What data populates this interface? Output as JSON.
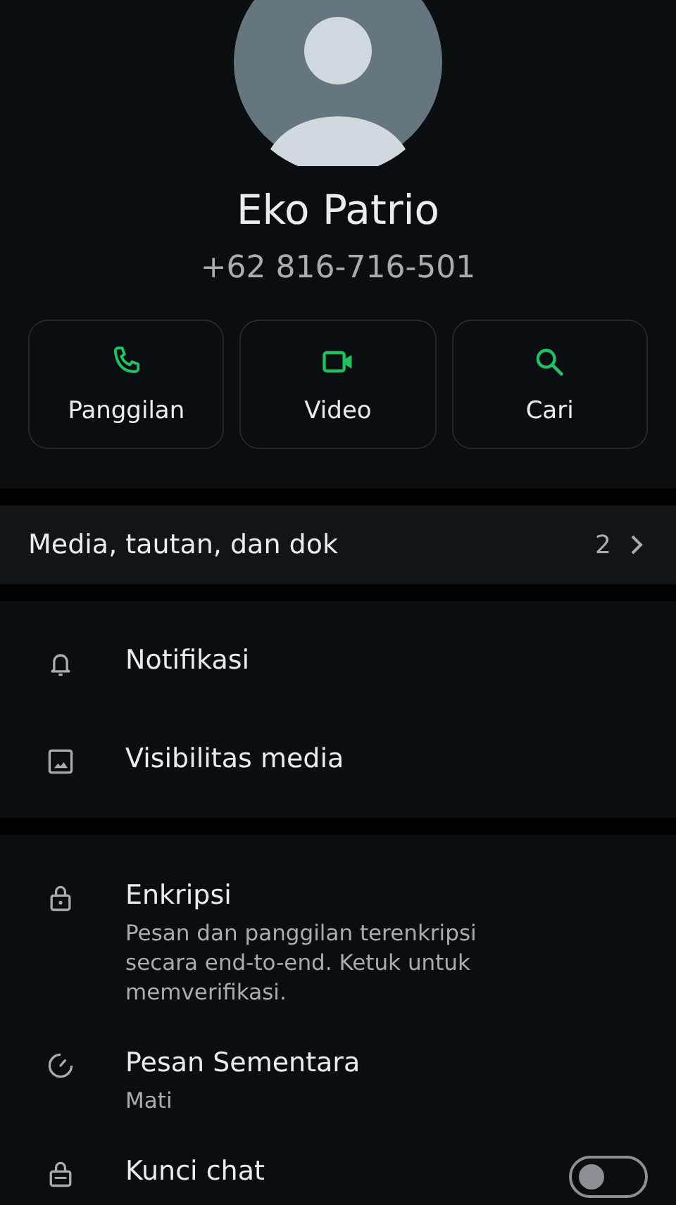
{
  "contact": {
    "name": "Eko Patrio",
    "phone": "+62 816-716-501"
  },
  "actions": [
    {
      "kind": "call",
      "label": "Panggilan"
    },
    {
      "kind": "video",
      "label": "Video"
    },
    {
      "kind": "search",
      "label": "Cari"
    }
  ],
  "media": {
    "label": "Media, tautan, dan dok",
    "count": "2"
  },
  "settings_1": [
    {
      "kind": "bell",
      "title": "Notifikasi"
    },
    {
      "kind": "image",
      "title": "Visibilitas media"
    }
  ],
  "settings_2": [
    {
      "kind": "lock",
      "title": "Enkripsi",
      "subtitle": "Pesan dan panggilan terenkripsi secara end-to-end. Ketuk untuk memverifikasi."
    },
    {
      "kind": "timer",
      "title": "Pesan Sementara",
      "subtitle": "Mati"
    },
    {
      "kind": "lockchat",
      "title": "Kunci chat",
      "on": false
    }
  ]
}
